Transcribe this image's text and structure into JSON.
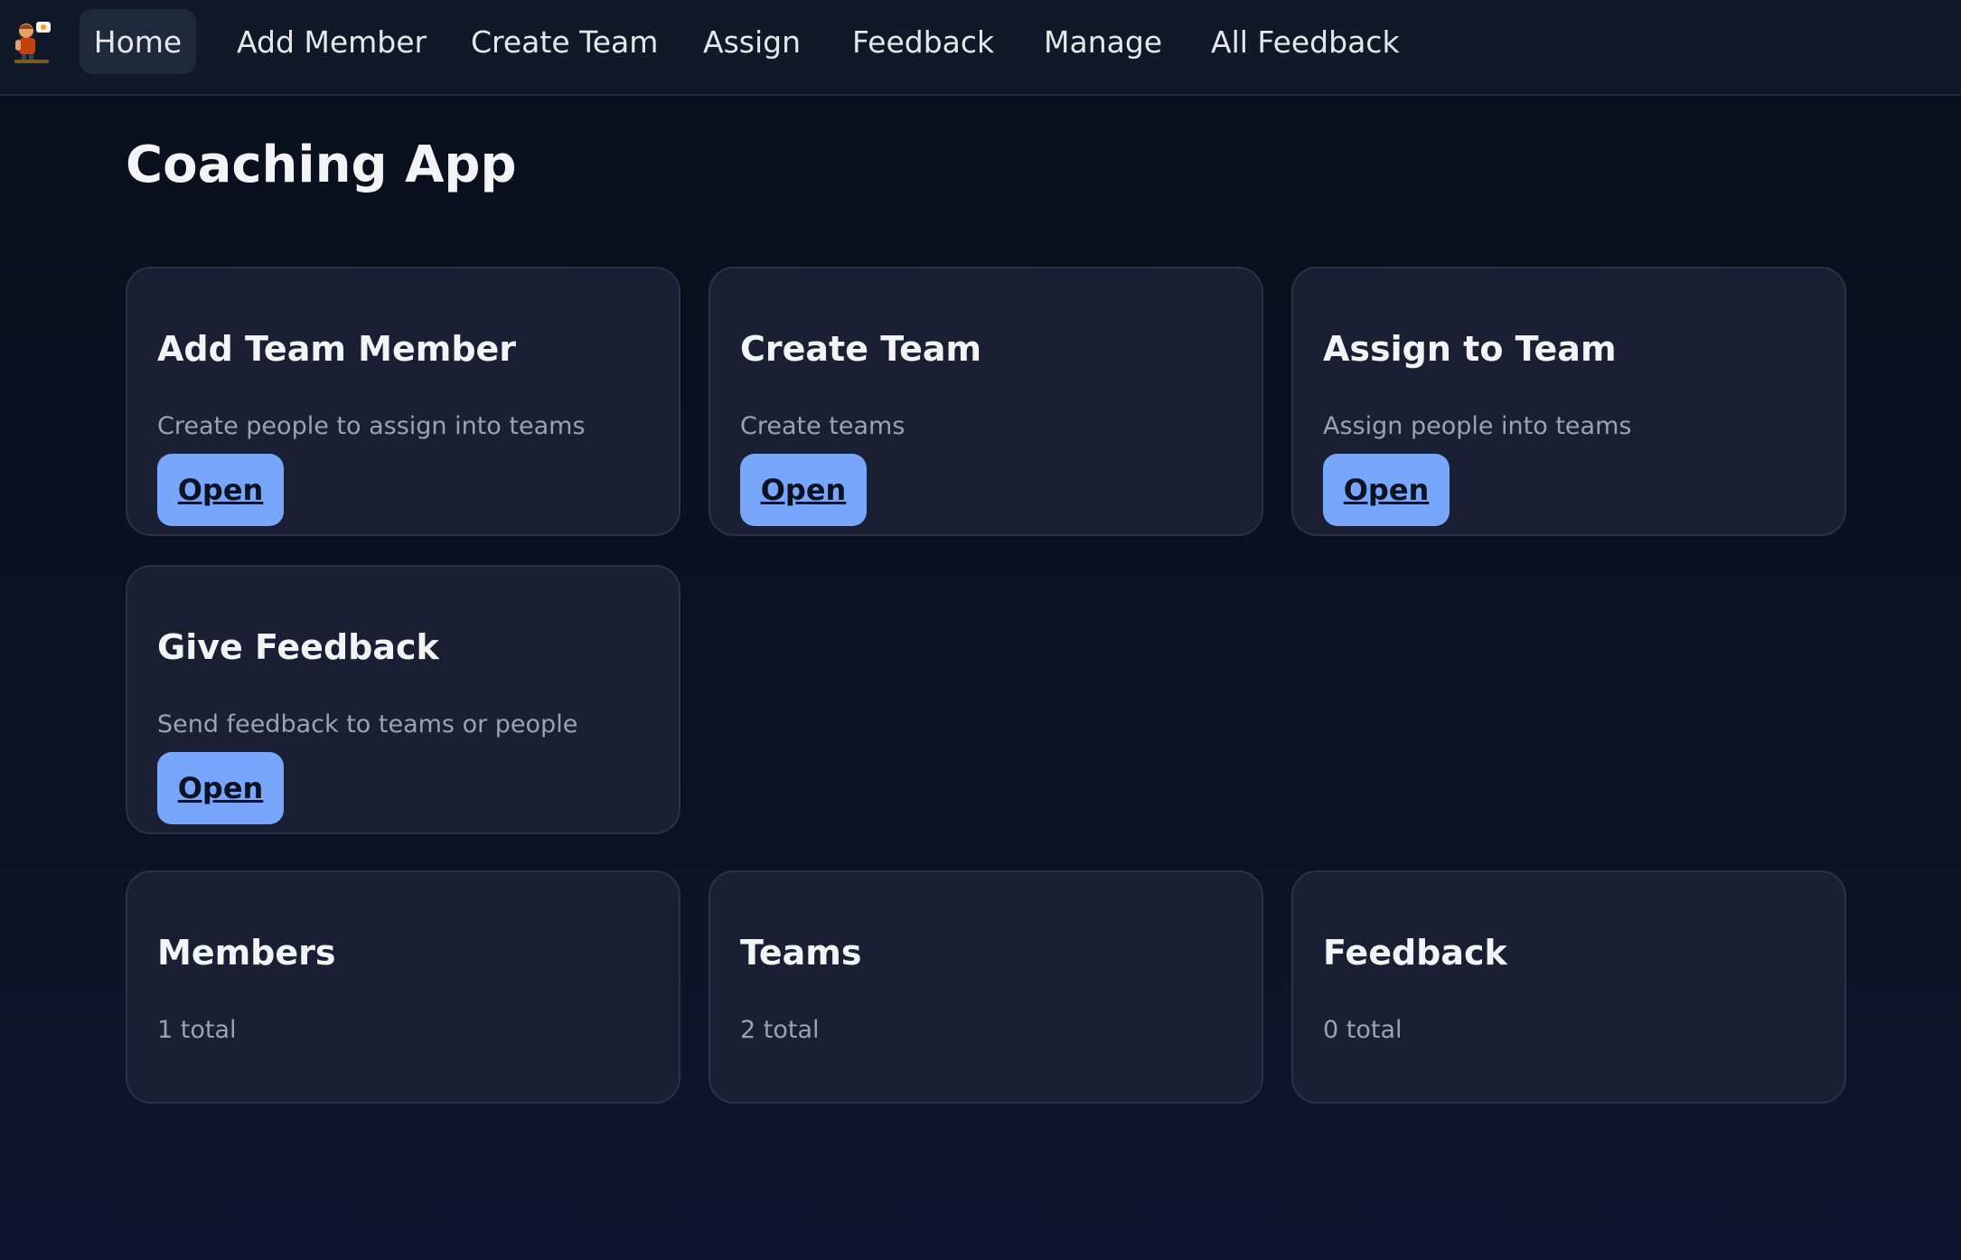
{
  "nav": {
    "logo_icon": "coach-mascot-icon",
    "items": [
      {
        "label": "Home",
        "active": true
      },
      {
        "label": "Add Member",
        "active": false
      },
      {
        "label": "Create Team",
        "active": false
      },
      {
        "label": "Assign",
        "active": false
      },
      {
        "label": "Feedback",
        "active": false
      },
      {
        "label": "Manage",
        "active": false
      },
      {
        "label": "All Feedback",
        "active": false
      }
    ]
  },
  "page": {
    "title": "Coaching App"
  },
  "actions": [
    {
      "title": "Add Team Member",
      "description": "Create people to assign into teams",
      "button_label": "Open"
    },
    {
      "title": "Create Team",
      "description": "Create teams",
      "button_label": "Open"
    },
    {
      "title": "Assign to Team",
      "description": "Assign people into teams",
      "button_label": "Open"
    },
    {
      "title": "Give Feedback",
      "description": "Send feedback to teams or people",
      "button_label": "Open"
    }
  ],
  "stats": [
    {
      "title": "Members",
      "value": "1 total"
    },
    {
      "title": "Teams",
      "value": "2 total"
    },
    {
      "title": "Feedback",
      "value": "0 total"
    }
  ],
  "colors": {
    "background": "#0a0f1c",
    "nav_background": "#111827",
    "card_background": "#1a1f33",
    "button_accent": "#78a6fb"
  }
}
